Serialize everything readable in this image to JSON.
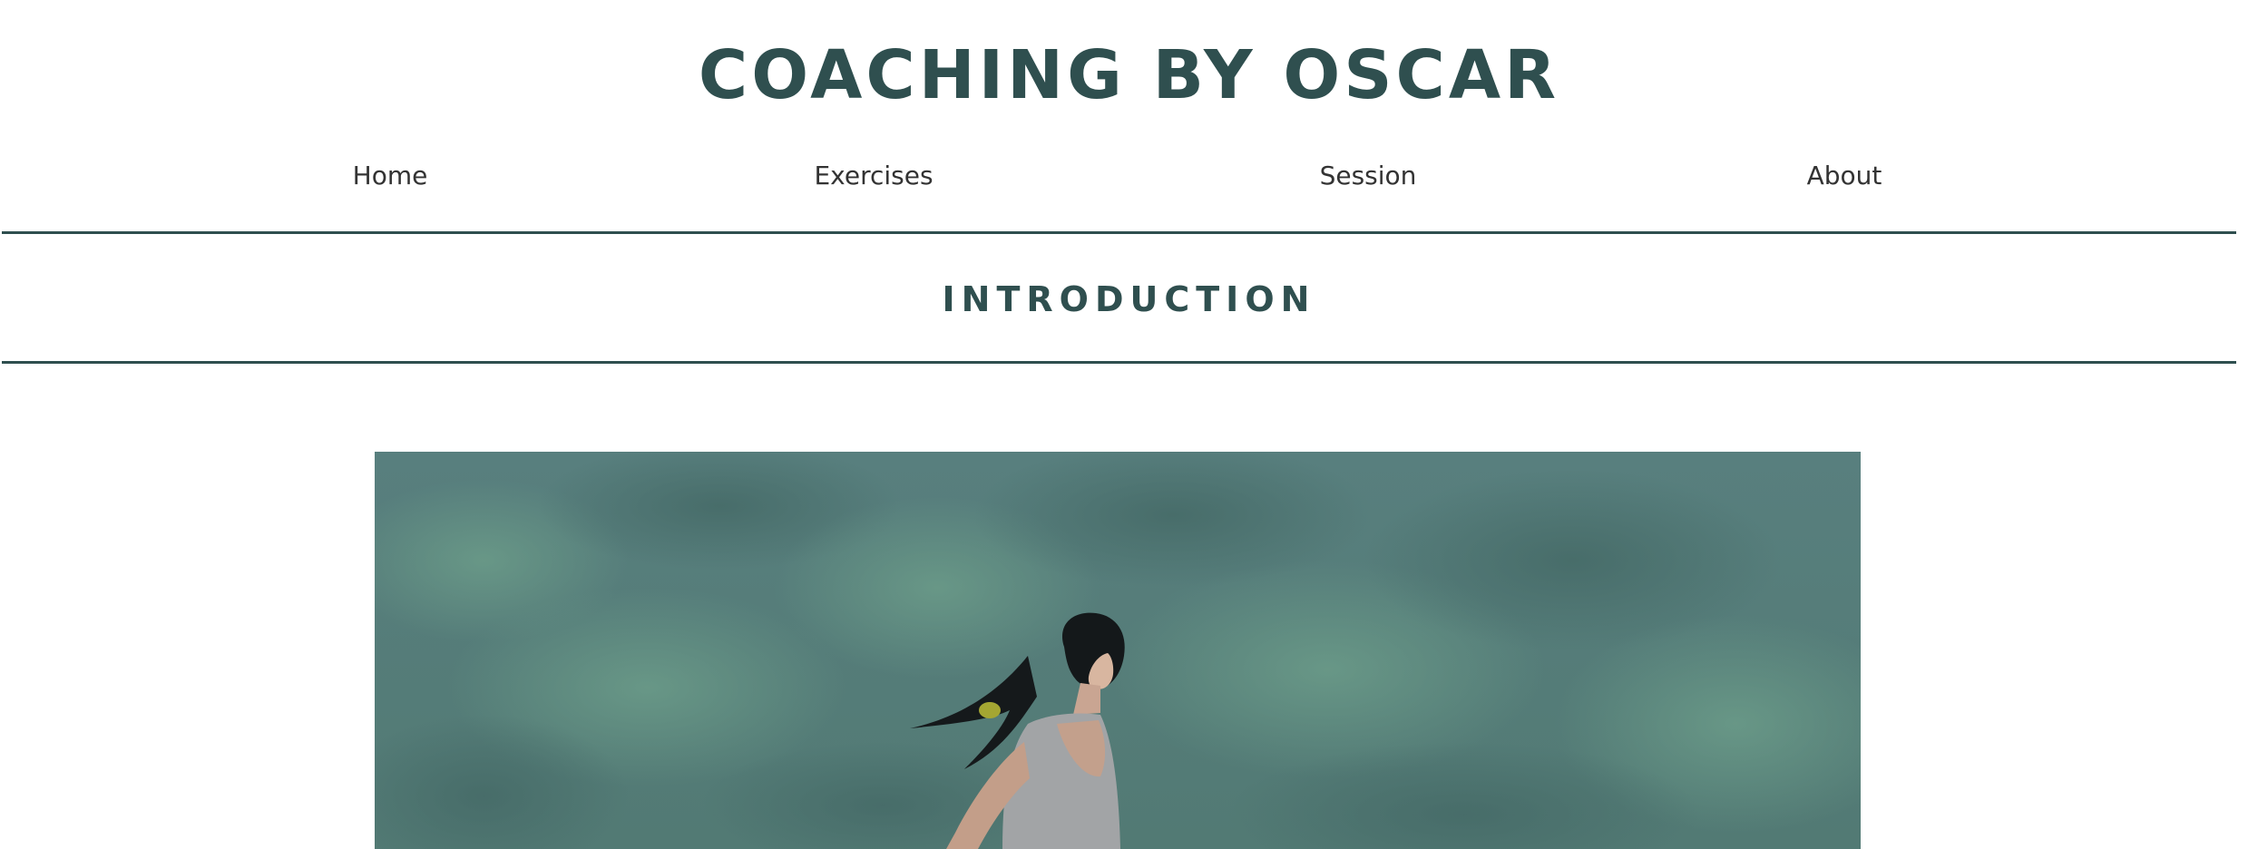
{
  "header": {
    "site_title": "COACHING BY OSCAR"
  },
  "nav": {
    "items": [
      {
        "label": "Home"
      },
      {
        "label": "Exercises"
      },
      {
        "label": "Session"
      },
      {
        "label": "About"
      }
    ]
  },
  "main": {
    "section_title": "INTRODUCTION"
  },
  "colors": {
    "primary": "#2f4f4f",
    "nav_text": "#333333",
    "background": "#ffffff",
    "hero_background": "#557c78"
  }
}
